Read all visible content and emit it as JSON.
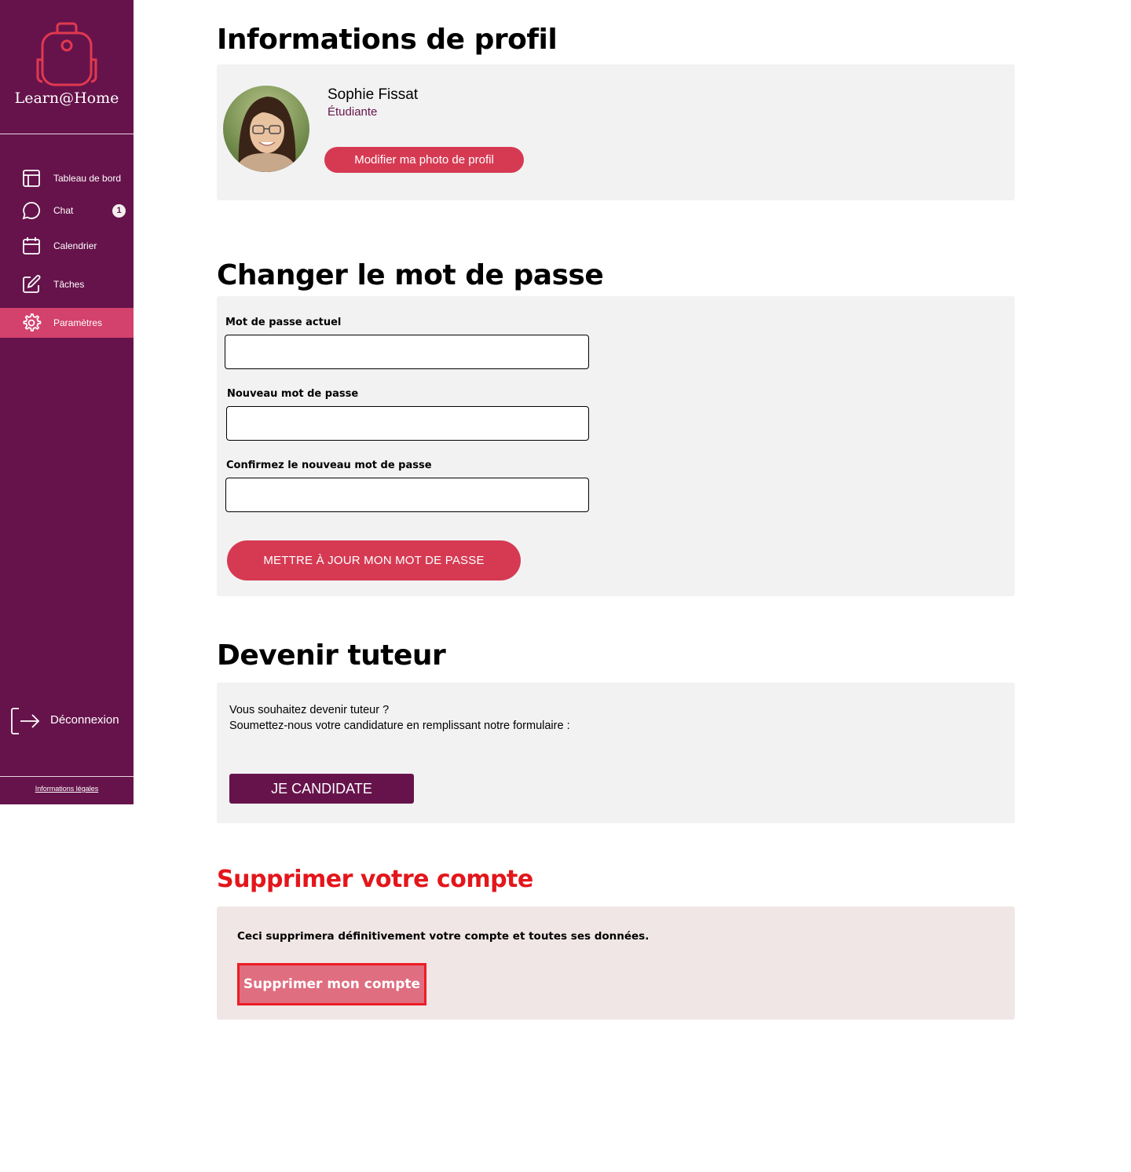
{
  "app": {
    "name": "Learn@Home",
    "colors": {
      "primary": "#66134b",
      "accent": "#d63a53",
      "danger": "#e3161b",
      "card": "#f2f2f2"
    }
  },
  "sidebar": {
    "items": [
      {
        "label": "Tableau de bord",
        "icon": "layout-icon"
      },
      {
        "label": "Chat",
        "icon": "chat-bubble-icon",
        "badge": "1"
      },
      {
        "label": "Calendrier",
        "icon": "calendar-icon"
      },
      {
        "label": "Tâches",
        "icon": "edit-icon"
      },
      {
        "label": "Paramètres",
        "icon": "gear-icon",
        "active": true
      }
    ],
    "logout_label": "Déconnexion",
    "legal_label": "Informations légales"
  },
  "profile": {
    "title": "Informations de profil",
    "name": "Sophie Fissat",
    "role": "Étudiante",
    "photo_button": "Modifier ma photo de profil"
  },
  "password": {
    "title": "Changer le mot de passe",
    "current_label": "Mot de passe actuel",
    "current_value": "",
    "new_label": "Nouveau mot de passe",
    "new_value": "",
    "confirm_label": "Confirmez le nouveau mot de passe",
    "confirm_value": "",
    "submit_label": "METTRE À JOUR MON MOT DE PASSE"
  },
  "tutor": {
    "title": "Devenir tuteur",
    "line1": "Vous souhaitez devenir tuteur ?",
    "line2": "Soumettez-nous votre candidature en remplissant notre formulaire :",
    "button_label": "JE CANDIDATE"
  },
  "delete_account": {
    "title": "Supprimer votre compte",
    "warning": "Ceci supprimera définitivement votre compte et toutes ses données.",
    "button_label": "Supprimer mon compte"
  }
}
